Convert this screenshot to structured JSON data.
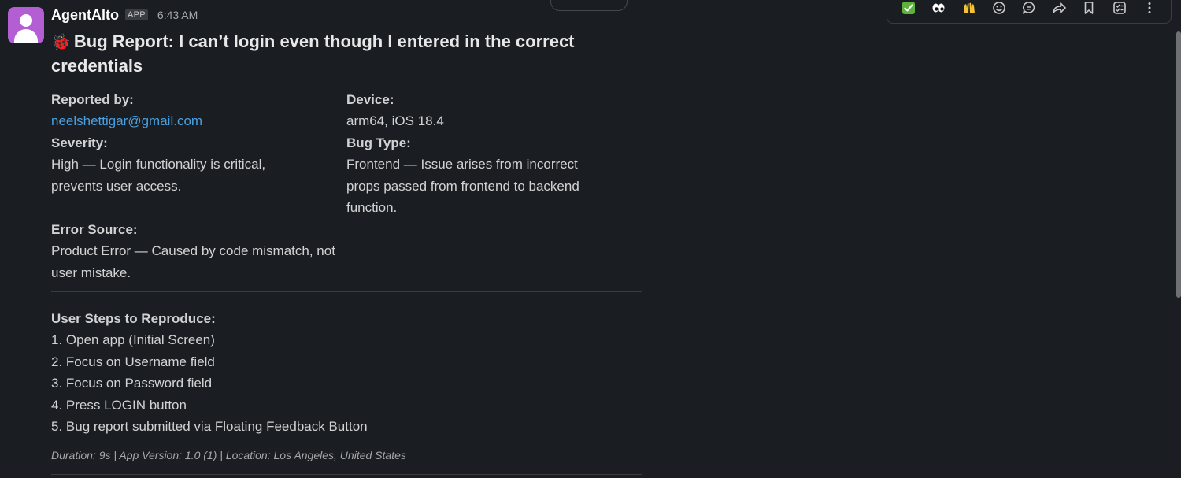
{
  "message": {
    "sender": "AgentAlto",
    "badge": "APP",
    "time": "6:43 AM",
    "title_emoji": "🐞",
    "title": "Bug Report: I can’t login even though I entered in the correct credentials",
    "reported_by_label": "Reported by:",
    "reported_by_value": "neelshettigar@gmail.com",
    "device_label": "Device:",
    "device_value": "arm64, iOS 18.4",
    "severity_label": "Severity:",
    "severity_value": "High — Login functionality is critical, prevents user access.",
    "bug_type_label": "Bug Type:",
    "bug_type_value": "Frontend — Issue arises from incorrect props passed from frontend to backend function.",
    "error_source_label": "Error Source:",
    "error_source_value": "Product Error — Caused by code mismatch, not user mistake.",
    "steps_label": "User Steps to Reproduce:",
    "steps": [
      "1. Open app (Initial Screen)",
      "2. Focus on Username field",
      "3. Focus on Password field",
      "4. Press LOGIN button",
      "5. Bug report submitted via Floating Feedback Button"
    ],
    "footer": "Duration: 9s | App Version: 1.0 (1) | Location: Los Angeles, United States"
  },
  "toolbar": {
    "items": [
      {
        "name": "react-check",
        "icon": "check-mark-emoji"
      },
      {
        "name": "react-eyes",
        "icon": "eyes-emoji"
      },
      {
        "name": "react-raised-hands",
        "icon": "raised-hands-emoji"
      },
      {
        "name": "add-reaction",
        "icon": "smile-icon"
      },
      {
        "name": "reply-in-thread",
        "icon": "comment-icon"
      },
      {
        "name": "forward",
        "icon": "share-arrow-icon"
      },
      {
        "name": "save",
        "icon": "bookmark-icon"
      },
      {
        "name": "add-to-list",
        "icon": "list-check-icon"
      },
      {
        "name": "more-actions",
        "icon": "vertical-dots-icon"
      }
    ]
  },
  "colors": {
    "background": "#1a1d21",
    "text": "#d1d2d3",
    "link": "#4a9fe0",
    "avatar": "#b35fd3"
  }
}
